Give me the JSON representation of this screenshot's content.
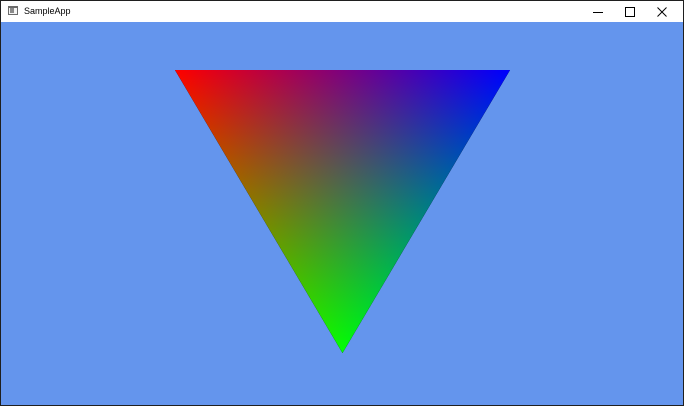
{
  "window": {
    "title": "SampleApp",
    "controls": {
      "minimize": "minimize-icon",
      "maximize": "maximize-icon",
      "close": "close-icon"
    }
  },
  "viewport": {
    "clear_color": "#6495ed",
    "triangle": {
      "vertex_colors": {
        "top_left": "#ff0000",
        "top_right": "#0000ff",
        "bottom": "#00ff00"
      }
    }
  }
}
